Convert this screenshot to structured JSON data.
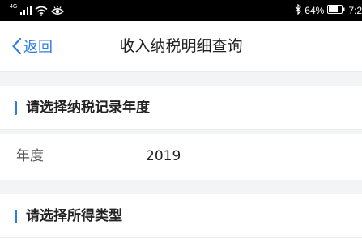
{
  "status_bar": {
    "signal_text": "4G",
    "battery_text": "64%",
    "time_text": "7:2"
  },
  "nav": {
    "back_label": "返回",
    "title": "收入纳税明细查询"
  },
  "sections": [
    {
      "title": "请选择纳税记录年度"
    },
    {
      "title": "请选择所得类型"
    }
  ],
  "year_field": {
    "label": "年度",
    "value": "2019"
  },
  "colors": {
    "accent": "#2f7de1",
    "background": "#f3f4f6"
  }
}
